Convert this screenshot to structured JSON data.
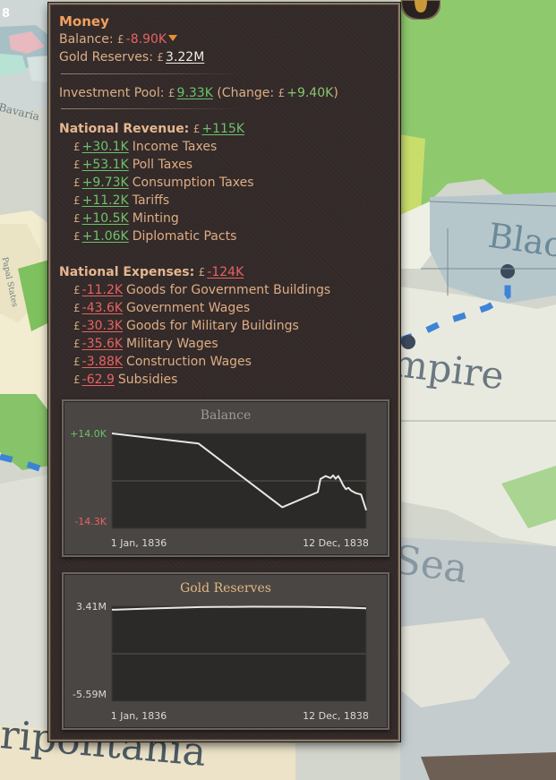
{
  "map": {
    "top_left_number": "8",
    "labels": [
      "Bavaria",
      "Black",
      "mpire",
      "Sea",
      "ripolitania",
      "Papal States"
    ]
  },
  "money": {
    "title": "Money",
    "balance_label": "Balance:",
    "balance_value": "-8.90K",
    "gold_label": "Gold Reserves:",
    "gold_value": "3.22M",
    "investment_label": "Investment Pool:",
    "investment_value": "9.33K",
    "change_open": "(Change:",
    "change_value": "+9.40K",
    "change_close": ")",
    "pound_symbol": "£"
  },
  "revenue": {
    "label": "National Revenue:",
    "total": "+115K",
    "items": [
      {
        "value": "+30.1K",
        "name": "Income Taxes"
      },
      {
        "value": "+53.1K",
        "name": "Poll Taxes"
      },
      {
        "value": "+9.73K",
        "name": "Consumption Taxes"
      },
      {
        "value": "+11.2K",
        "name": "Tariffs"
      },
      {
        "value": "+10.5K",
        "name": "Minting"
      },
      {
        "value": "+1.06K",
        "name": "Diplomatic Pacts"
      }
    ]
  },
  "expenses": {
    "label": "National Expenses:",
    "total": "-124K",
    "items": [
      {
        "value": "-11.2K",
        "name": "Goods for Government Buildings"
      },
      {
        "value": "-43.6K",
        "name": "Government Wages"
      },
      {
        "value": "-30.3K",
        "name": "Goods for Military Buildings"
      },
      {
        "value": "-35.6K",
        "name": "Military Wages"
      },
      {
        "value": "-3.88K",
        "name": "Construction Wages"
      },
      {
        "value": "-62.9",
        "name": "Subsidies"
      }
    ]
  },
  "colors": {
    "positive": "#6cc26a",
    "negative": "#e86262",
    "title": "#f0a05e",
    "panel": "#332a29"
  },
  "chart_data": [
    {
      "type": "line",
      "title": "Balance",
      "ytick_labels": [
        "+14.0K",
        "-14.3K"
      ],
      "xtick_labels": [
        "1 Jan, 1836",
        "12 Dec, 1838"
      ],
      "ylim": [
        -14300,
        14000
      ],
      "x": [
        0,
        0.34,
        0.67,
        0.81,
        0.82,
        0.84,
        0.86,
        0.87,
        0.88,
        0.89,
        0.9,
        0.91,
        0.92,
        0.93,
        0.94,
        0.96,
        0.98,
        1.0
      ],
      "values": [
        14000,
        11000,
        -8000,
        -3500,
        400,
        1300,
        700,
        1500,
        500,
        1300,
        0,
        -1500,
        -2600,
        -2200,
        -3000,
        -3800,
        -4200,
        -8900
      ],
      "grid": true
    },
    {
      "type": "line",
      "title": "Gold Reserves",
      "ytick_labels": [
        "3.41M",
        "-5.59M"
      ],
      "xtick_labels": [
        "1 Jan, 1836",
        "12 Dec, 1838"
      ],
      "ylim": [
        -5590000,
        3410000
      ],
      "x": [
        0,
        0.15,
        0.35,
        0.55,
        0.75,
        0.9,
        1.0
      ],
      "values": [
        3080000,
        3200000,
        3330000,
        3370000,
        3360000,
        3300000,
        3220000
      ],
      "grid": true
    }
  ]
}
